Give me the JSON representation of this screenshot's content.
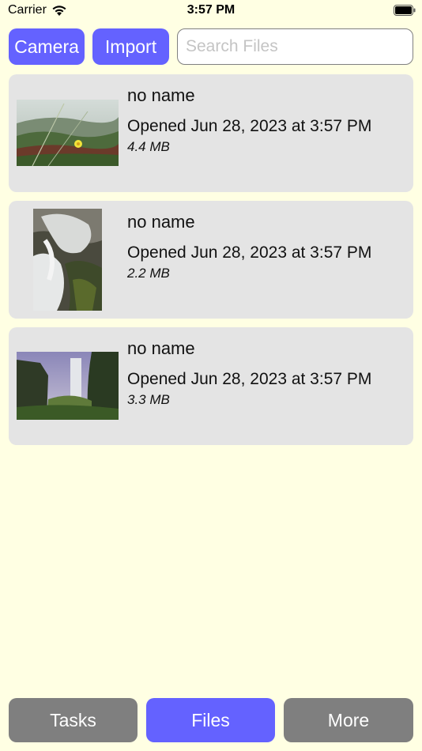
{
  "status_bar": {
    "carrier": "Carrier",
    "time": "3:57 PM"
  },
  "toolbar": {
    "camera_label": "Camera",
    "import_label": "Import",
    "search_placeholder": "Search Files",
    "search_value": ""
  },
  "files": [
    {
      "name": "no name",
      "opened": "Opened Jun 28, 2023 at 3:57 PM",
      "size": "4.4 MB",
      "thumbnail": "meadow-flower-photo"
    },
    {
      "name": "no name",
      "opened": "Opened Jun 28, 2023 at 3:57 PM",
      "size": "2.2 MB",
      "thumbnail": "waterfall-rocks-photo"
    },
    {
      "name": "no name",
      "opened": "Opened Jun 28, 2023 at 3:57 PM",
      "size": "3.3 MB",
      "thumbnail": "waterfall-cliff-photo"
    }
  ],
  "tabs": [
    {
      "label": "Tasks",
      "selected": false
    },
    {
      "label": "Files",
      "selected": true
    },
    {
      "label": "More",
      "selected": false
    }
  ],
  "colors": {
    "background": "#ffffe3",
    "accent": "#6462ff",
    "tab_inactive": "#7f7f7f",
    "card": "#e4e4e4"
  }
}
